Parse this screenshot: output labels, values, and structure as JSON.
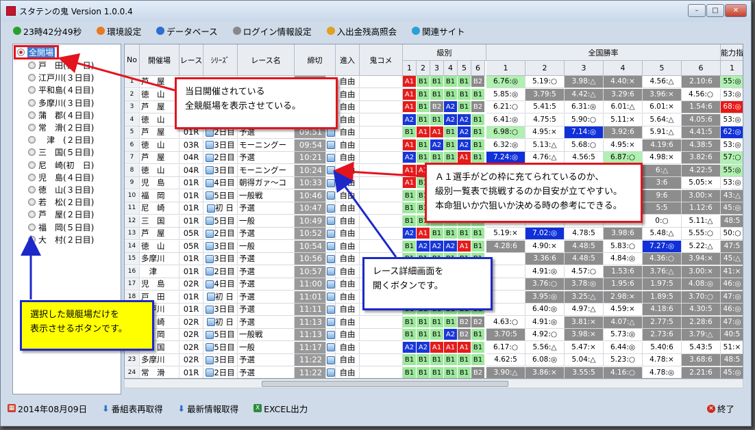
{
  "window": {
    "title": "スタテンの鬼 Version 1.0.0.4",
    "minimize": "–",
    "maximize": "□",
    "close": "✕"
  },
  "toolbar": [
    {
      "label": "23時42分49秒",
      "icon": "clock-icon",
      "color": "#2aa02a"
    },
    {
      "label": "環境設定",
      "icon": "gear-icon",
      "color": "#e87a1c"
    },
    {
      "label": "データベース",
      "icon": "database-icon",
      "color": "#2c6fd0"
    },
    {
      "label": "ログイン情報設定",
      "icon": "document-icon",
      "color": "#888888"
    },
    {
      "label": "入出金残高照会",
      "icon": "key-icon",
      "color": "#e0a020"
    },
    {
      "label": "関連サイト",
      "icon": "globe-icon",
      "color": "#2aa0d8"
    }
  ],
  "tree": {
    "all": "全開場",
    "items": [
      "戸　田(初　日)",
      "江戸川(３日目)",
      "平和島(４日目)",
      "多摩川(３日目)",
      "蒲　郡(４日目)",
      "常　滑(２日目)",
      "　津　(２日目)",
      "三　国(５日目)",
      "尼　崎(初　日)",
      "児　島(４日目)",
      "徳　山(３日目)",
      "若　松(２日目)",
      "芦　屋(２日目)",
      "福　岡(５日目)",
      "大　村(２日目)"
    ]
  },
  "headers": {
    "no": "No",
    "venue": "開催場",
    "race": "レース",
    "series": "ｼﾘｰｽﾞ",
    "name": "レース名",
    "deadline": "締切",
    "entry": "進入",
    "comment": "鬼コメ",
    "class": "級別",
    "nat": "全国勝率",
    "ability": "能力指",
    "lanes": [
      "1",
      "2",
      "3",
      "4",
      "5",
      "6"
    ],
    "ability_lane": "1"
  },
  "rows": [
    {
      "no": "1",
      "venue": "芦　屋",
      "race": "",
      "series": "",
      "name": "",
      "time": "",
      "entry": "自由",
      "kyu": [
        "A1",
        "B1",
        "B1",
        "B1",
        "B1",
        "B2"
      ],
      "wr": [
        [
          "6.76:◎",
          "lg"
        ],
        [
          "5.19:○",
          "w"
        ],
        [
          "3.98:△",
          "g"
        ],
        [
          "4.40:×",
          "g"
        ],
        [
          "4.56:△",
          "w"
        ],
        [
          "2.10:6",
          "g"
        ]
      ],
      "ab": [
        "55:◎",
        "lg"
      ]
    },
    {
      "no": "2",
      "venue": "徳　山",
      "race": "",
      "series": "",
      "name": "",
      "time": "",
      "entry": "自由",
      "kyu": [
        "A1",
        "B1",
        "B1",
        "B1",
        "B1",
        "B1"
      ],
      "wr": [
        [
          "5.85:◎",
          "w"
        ],
        [
          "3.79:5",
          "g"
        ],
        [
          "4.42:△",
          "g"
        ],
        [
          "3.29:6",
          "g"
        ],
        [
          "3.96:×",
          "g"
        ],
        [
          "4.56:○",
          "w"
        ]
      ],
      "ab": [
        "53:◎",
        "w"
      ]
    },
    {
      "no": "3",
      "venue": "芦　屋",
      "race": "",
      "series": "",
      "name": "",
      "time": "",
      "entry": "自由",
      "kyu": [
        "A1",
        "B1",
        "B2",
        "A2",
        "B1",
        "B2"
      ],
      "wr": [
        [
          "6.21:○",
          "w"
        ],
        [
          "5.41:5",
          "w"
        ],
        [
          "6.31:◎",
          "w"
        ],
        [
          "6.01:△",
          "w"
        ],
        [
          "6.01:×",
          "w"
        ],
        [
          "1.54:6",
          "g"
        ]
      ],
      "ab": [
        "68:◎",
        "rd"
      ]
    },
    {
      "no": "4",
      "venue": "徳　山",
      "race": "",
      "series": "",
      "name": "",
      "time": "",
      "entry": "自由",
      "kyu": [
        "A2",
        "B1",
        "B1",
        "A2",
        "A2",
        "B1"
      ],
      "wr": [
        [
          "6.41:◎",
          "w"
        ],
        [
          "4.75:5",
          "w"
        ],
        [
          "5.90:○",
          "w"
        ],
        [
          "5.11:×",
          "w"
        ],
        [
          "5.64:△",
          "w"
        ],
        [
          "4.05:6",
          "g"
        ]
      ],
      "ab": [
        "53:◎",
        "w"
      ]
    },
    {
      "no": "5",
      "venue": "芦　屋",
      "race": "01R",
      "series": "2日目",
      "name": "予選",
      "time": "09:51",
      "entry": "自由",
      "kyu": [
        "B1",
        "A1",
        "A1",
        "B1",
        "A2",
        "B1"
      ],
      "wr": [
        [
          "6.98:○",
          "lg"
        ],
        [
          "4.95:×",
          "w"
        ],
        [
          "7.14:◎",
          "bl"
        ],
        [
          "3.92:6",
          "g"
        ],
        [
          "5.91:△",
          "w"
        ],
        [
          "4.41:5",
          "g"
        ]
      ],
      "ab": [
        "62:◎",
        "bl"
      ]
    },
    {
      "no": "6",
      "venue": "徳　山",
      "race": "03R",
      "series": "3日目",
      "name": "モーニングー",
      "time": "09:54",
      "entry": "自由",
      "kyu": [
        "A1",
        "B1",
        "A2",
        "B1",
        "A2",
        "B1"
      ],
      "wr": [
        [
          "6.32:◎",
          "w"
        ],
        [
          "5.13:△",
          "w"
        ],
        [
          "5.68:○",
          "w"
        ],
        [
          "4.95:×",
          "w"
        ],
        [
          "4.19:6",
          "g"
        ],
        [
          "4.38:5",
          "g"
        ]
      ],
      "ab": [
        "53:◎",
        "w"
      ]
    },
    {
      "no": "7",
      "venue": "芦　屋",
      "race": "04R",
      "series": "2日目",
      "name": "予選",
      "time": "10:21",
      "entry": "自由",
      "kyu": [
        "A2",
        "B1",
        "B1",
        "B1",
        "A1",
        "B1"
      ],
      "wr": [
        [
          "7.24:◎",
          "bl"
        ],
        [
          "4.76:△",
          "w"
        ],
        [
          "4.56:5",
          "w"
        ],
        [
          "6.87:○",
          "lg"
        ],
        [
          "4.98:×",
          "w"
        ],
        [
          "3.82:6",
          "g"
        ]
      ],
      "ab": [
        "57:○",
        "lg"
      ]
    },
    {
      "no": "8",
      "venue": "徳　山",
      "race": "04R",
      "series": "3日目",
      "name": "モーニングー",
      "time": "10:24",
      "entry": "自由",
      "kyu": [
        "A1",
        "A1",
        "B1",
        "B1",
        "B1",
        "B1"
      ],
      "wr": [
        [
          "",
          "w"
        ],
        [
          "",
          "w"
        ],
        [
          "",
          "w"
        ],
        [
          "",
          "w"
        ],
        [
          "6:△",
          "g"
        ],
        [
          "4.22:5",
          "g"
        ]
      ],
      "ab": [
        "55:◎",
        "lg"
      ]
    },
    {
      "no": "9",
      "venue": "児　島",
      "race": "01R",
      "series": "4日目",
      "name": "朝得ガァ～コ",
      "time": "10:33",
      "entry": "自由",
      "kyu": [
        "A1",
        "B1",
        "B1",
        "B1",
        "B1",
        "B1"
      ],
      "wr": [
        [
          "",
          "w"
        ],
        [
          "",
          "w"
        ],
        [
          "",
          "w"
        ],
        [
          "",
          "w"
        ],
        [
          "3:6",
          "g"
        ],
        [
          "5.05:×",
          "w"
        ]
      ],
      "ab": [
        "53:◎",
        "w"
      ]
    },
    {
      "no": "10",
      "venue": "福　岡",
      "race": "01R",
      "series": "5日目",
      "name": "一般戦",
      "time": "10:46",
      "entry": "自由",
      "kyu": [
        "B1",
        "B1",
        "B1",
        "B1",
        "B1",
        "B1"
      ],
      "wr": [
        [
          "",
          "w"
        ],
        [
          "",
          "w"
        ],
        [
          "",
          "w"
        ],
        [
          "",
          "w"
        ],
        [
          "9:6",
          "g"
        ],
        [
          "3.00:×",
          "g"
        ]
      ],
      "ab": [
        "43:△",
        "g"
      ]
    },
    {
      "no": "11",
      "venue": "尼　崎",
      "race": "01R",
      "series": "初 日",
      "name": "予選",
      "time": "10:47",
      "entry": "自由",
      "kyu": [
        "B1",
        "B1",
        "B1",
        "B1",
        "B1",
        "B1"
      ],
      "wr": [
        [
          "",
          "w"
        ],
        [
          "",
          "w"
        ],
        [
          "",
          "w"
        ],
        [
          "",
          "w"
        ],
        [
          "5:5",
          "g"
        ],
        [
          "1.12:6",
          "g"
        ]
      ],
      "ab": [
        "45:◎",
        "g"
      ]
    },
    {
      "no": "12",
      "venue": "三　国",
      "race": "01R",
      "series": "5日目",
      "name": "一般",
      "time": "10:49",
      "entry": "自由",
      "kyu": [
        "B1",
        "B1",
        "B1",
        "B1",
        "B1",
        "B1"
      ],
      "wr": [
        [
          "",
          "w"
        ],
        [
          "",
          "w"
        ],
        [
          "",
          "w"
        ],
        [
          "",
          "w"
        ],
        [
          "0:○",
          "w"
        ],
        [
          "5.11:△",
          "w"
        ]
      ],
      "ab": [
        "48:5",
        "g"
      ]
    },
    {
      "no": "13",
      "venue": "芦　屋",
      "race": "05R",
      "series": "2日目",
      "name": "予選",
      "time": "10:52",
      "entry": "自由",
      "kyu": [
        "A2",
        "A1",
        "B1",
        "B1",
        "B1",
        "B1"
      ],
      "wr": [
        [
          "5.19:×",
          "w"
        ],
        [
          "7.02:◎",
          "bl"
        ],
        [
          "4.78:5",
          "w"
        ],
        [
          "3.98:6",
          "g"
        ],
        [
          "5.48:△",
          "w"
        ],
        [
          "5.55:○",
          "w"
        ]
      ],
      "ab": [
        "50:○",
        "w"
      ]
    },
    {
      "no": "14",
      "venue": "徳　山",
      "race": "05R",
      "series": "3日目",
      "name": "一般",
      "time": "10:54",
      "entry": "自由",
      "kyu": [
        "B1",
        "A2",
        "A2",
        "A2",
        "A1",
        "B1"
      ],
      "wr": [
        [
          "4.28:6",
          "g"
        ],
        [
          "4.90:×",
          "w"
        ],
        [
          "4.48:5",
          "g"
        ],
        [
          "5.83:○",
          "w"
        ],
        [
          "7.27:◎",
          "bl"
        ],
        [
          "5.22:△",
          "w"
        ]
      ],
      "ab": [
        "47:5",
        "g"
      ]
    },
    {
      "no": "15",
      "venue": "多摩川",
      "race": "01R",
      "series": "3日目",
      "name": "予選",
      "time": "10:56",
      "entry": "自由",
      "kyu": [
        "B1",
        "B1",
        "B1",
        "B1",
        "B1",
        "B1"
      ],
      "wr": [
        [
          "",
          "w"
        ],
        [
          "3.36:6",
          "g"
        ],
        [
          "4.48:5",
          "g"
        ],
        [
          "4.84:◎",
          "w"
        ],
        [
          "4.36:○",
          "g"
        ],
        [
          "3.94:×",
          "g"
        ]
      ],
      "ab": [
        "45:△",
        "g"
      ]
    },
    {
      "no": "16",
      "venue": "　津　",
      "race": "01R",
      "series": "2日目",
      "name": "予選",
      "time": "10:57",
      "entry": "自由",
      "kyu": [
        "B1",
        "B1",
        "B1",
        "B1",
        "B1",
        "B1"
      ],
      "wr": [
        [
          "",
          "w"
        ],
        [
          "4.91:◎",
          "w"
        ],
        [
          "4.57:○",
          "w"
        ],
        [
          "1.53:6",
          "g"
        ],
        [
          "3.76:△",
          "g"
        ],
        [
          "3.00:×",
          "g"
        ]
      ],
      "ab": [
        "41:×",
        "g"
      ]
    },
    {
      "no": "17",
      "venue": "児　島",
      "race": "02R",
      "series": "4日目",
      "name": "予選",
      "time": "11:00",
      "entry": "自由",
      "kyu": [
        "B1",
        "B1",
        "B1",
        "B1",
        "B1",
        "B1"
      ],
      "wr": [
        [
          "",
          "w"
        ],
        [
          "3.76:○",
          "g"
        ],
        [
          "3.78:◎",
          "g"
        ],
        [
          "1.95:6",
          "g"
        ],
        [
          "1.97:5",
          "g"
        ],
        [
          "4.08:◎",
          "g"
        ]
      ],
      "ab": [
        "46:◎",
        "g"
      ]
    },
    {
      "no": "18",
      "venue": "戸　田",
      "race": "01R",
      "series": "初 日",
      "name": "予選",
      "time": "11:01",
      "entry": "自由",
      "kyu": [
        "B1",
        "B1",
        "B1",
        "B1",
        "B1",
        "B1"
      ],
      "wr": [
        [
          "",
          "w"
        ],
        [
          "3.95:◎",
          "g"
        ],
        [
          "3.25:△",
          "g"
        ],
        [
          "2.98:×",
          "g"
        ],
        [
          "1.89:5",
          "g"
        ],
        [
          "3.70:○",
          "g"
        ]
      ],
      "ab": [
        "47:◎",
        "g"
      ]
    },
    {
      "no": "19",
      "venue": "江戸川",
      "race": "01R",
      "series": "3日目",
      "name": "予選",
      "time": "11:11",
      "entry": "自由",
      "kyu": [
        "B1",
        "B1",
        "B1",
        "B1",
        "B1",
        "B1"
      ],
      "wr": [
        [
          "",
          "w"
        ],
        [
          "6.40:◎",
          "w"
        ],
        [
          "4.97:△",
          "w"
        ],
        [
          "4.59:×",
          "w"
        ],
        [
          "4.18:6",
          "g"
        ],
        [
          "4.30:5",
          "g"
        ]
      ],
      "ab": [
        "46:◎",
        "g"
      ]
    },
    {
      "no": "20",
      "venue": "尼　崎",
      "race": "02R",
      "series": "初 日",
      "name": "予選",
      "time": "11:13",
      "entry": "自由",
      "kyu": [
        "B1",
        "B1",
        "B1",
        "B1",
        "B2",
        "B2"
      ],
      "wr": [
        [
          "4.63:○",
          "w"
        ],
        [
          "4.91:◎",
          "w"
        ],
        [
          "3.81:×",
          "g"
        ],
        [
          "4.07:△",
          "g"
        ],
        [
          "2.77:5",
          "g"
        ],
        [
          "2.28:6",
          "g"
        ]
      ],
      "ab": [
        "47:◎",
        "g"
      ]
    },
    {
      "no": "21",
      "venue": "福　岡",
      "race": "02R",
      "series": "5日目",
      "name": "一般戦",
      "time": "11:13",
      "entry": "自由",
      "kyu": [
        "B1",
        "B1",
        "B1",
        "A2",
        "B2",
        "B1"
      ],
      "wr": [
        [
          "3.70:5",
          "g"
        ],
        [
          "4.92:○",
          "w"
        ],
        [
          "3.98:×",
          "g"
        ],
        [
          "5.73:◎",
          "w"
        ],
        [
          "2.73:6",
          "g"
        ],
        [
          "3.79:△",
          "g"
        ]
      ],
      "ab": [
        "40:5",
        "g"
      ]
    },
    {
      "no": "22",
      "venue": "三　国",
      "race": "02R",
      "series": "5日目",
      "name": "一般",
      "time": "11:17",
      "entry": "自由",
      "kyu": [
        "A2",
        "A2",
        "A1",
        "A1",
        "A1",
        "B1"
      ],
      "wr": [
        [
          "6.17:○",
          "w"
        ],
        [
          "5.56:△",
          "w"
        ],
        [
          "5.47:×",
          "w"
        ],
        [
          "6.44:◎",
          "w"
        ],
        [
          "5.40:6",
          "w"
        ],
        [
          "5.43:5",
          "w"
        ]
      ],
      "ab": [
        "51:×",
        "w"
      ]
    },
    {
      "no": "23",
      "venue": "多摩川",
      "race": "02R",
      "series": "3日目",
      "name": "予選",
      "time": "11:22",
      "entry": "自由",
      "kyu": [
        "B1",
        "B1",
        "B1",
        "B1",
        "B1",
        "B1"
      ],
      "wr": [
        [
          "4.62:5",
          "w"
        ],
        [
          "6.08:◎",
          "w"
        ],
        [
          "5.04:△",
          "w"
        ],
        [
          "5.23:○",
          "w"
        ],
        [
          "4.78:×",
          "w"
        ],
        [
          "3.68:6",
          "g"
        ]
      ],
      "ab": [
        "48:5",
        "g"
      ]
    },
    {
      "no": "24",
      "venue": "常　滑",
      "race": "01R",
      "series": "2日目",
      "name": "予選",
      "time": "11:22",
      "entry": "自由",
      "kyu": [
        "B1",
        "B1",
        "B1",
        "B1",
        "B1",
        "B2"
      ],
      "wr": [
        [
          "3.90:△",
          "g"
        ],
        [
          "3.86:×",
          "g"
        ],
        [
          "3.55:5",
          "g"
        ],
        [
          "4.16:○",
          "g"
        ],
        [
          "4.78:◎",
          "w"
        ],
        [
          "2.21:6",
          "g"
        ]
      ],
      "ab": [
        "45:◎",
        "g"
      ]
    }
  ],
  "status": {
    "date": "2014年08月09日",
    "reload": "番組表再取得",
    "latest": "最新情報取得",
    "excel": "EXCEL出力",
    "exit": "終了"
  },
  "annotations": {
    "venue_note": [
      "当日開催されている",
      "全競艇場を表示させている。"
    ],
    "class_note": [
      "Ａ１選手がどの枠に充てられているのか、",
      "級別一覧表で挑戦するのか目安が立てやすい。",
      "本命狙いか穴狙いか決める時の参考にできる。"
    ],
    "detail_note": [
      "レース詳細画面を",
      "開くボタンです。"
    ],
    "select_note": [
      "選択した競艇場だけを",
      "表示させるボタンです。"
    ]
  }
}
